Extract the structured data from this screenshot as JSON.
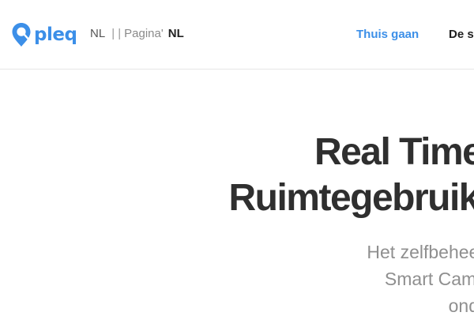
{
  "header": {
    "logo_text": "pleq",
    "language": {
      "current": "NL",
      "separator": "| |",
      "page_label": "Pagina'",
      "switch": "NL"
    },
    "nav": {
      "home": "Thuis gaan",
      "next": "De s"
    }
  },
  "hero": {
    "title_line1": "Real Time I",
    "title_line2": "Ruimtegebruik",
    "subtitle_line1": "Het zelfbeheer",
    "subtitle_line2": "Smart Camp",
    "subtitle_line3": "ond"
  },
  "colors": {
    "brand": "#3c8fe8",
    "title": "#2f2f2f",
    "subtitle": "#8f8f8f"
  },
  "icons": {
    "logo": "map-pin-icon"
  }
}
